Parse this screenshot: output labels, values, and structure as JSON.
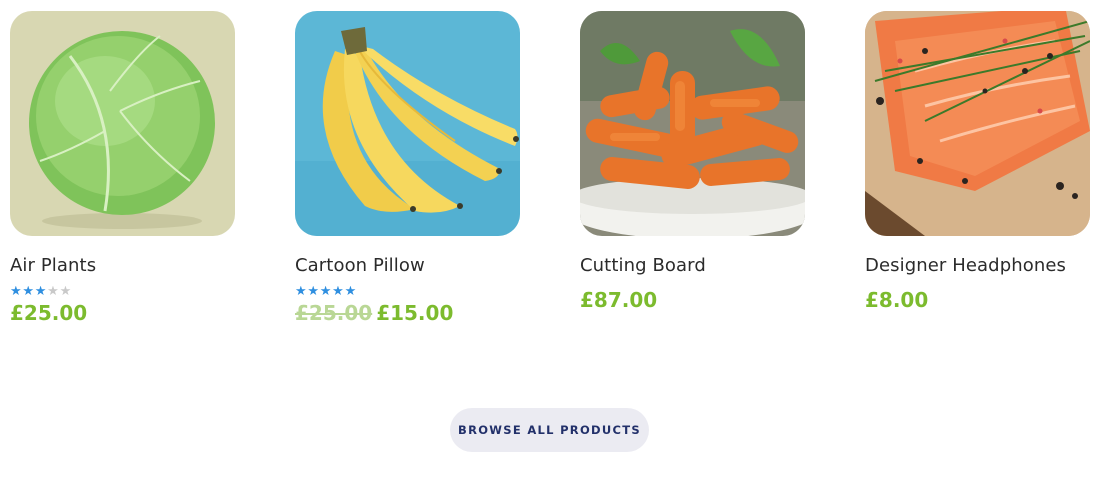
{
  "products": [
    {
      "name": "Air Plants",
      "image_icon": "cabbage-image",
      "rating": 3,
      "rating_max": 5,
      "price": "£25.00",
      "old_price": null
    },
    {
      "name": "Cartoon Pillow",
      "image_icon": "bananas-image",
      "rating": 5,
      "rating_max": 5,
      "price": "£15.00",
      "old_price": "£25.00"
    },
    {
      "name": "Cutting Board",
      "image_icon": "carrots-image",
      "rating": null,
      "rating_max": 5,
      "price": "£87.00",
      "old_price": null
    },
    {
      "name": "Designer Headphones",
      "image_icon": "salmon-image",
      "rating": null,
      "rating_max": 5,
      "price": "£8.00",
      "old_price": null
    }
  ],
  "browse_button": {
    "label": "BROWSE ALL PRODUCTS"
  },
  "colors": {
    "price": "#7cbb2e",
    "star_active": "#2f8fe0",
    "star_inactive": "#c9c9c9",
    "button_bg": "#ebebf2",
    "button_text": "#22306a"
  }
}
